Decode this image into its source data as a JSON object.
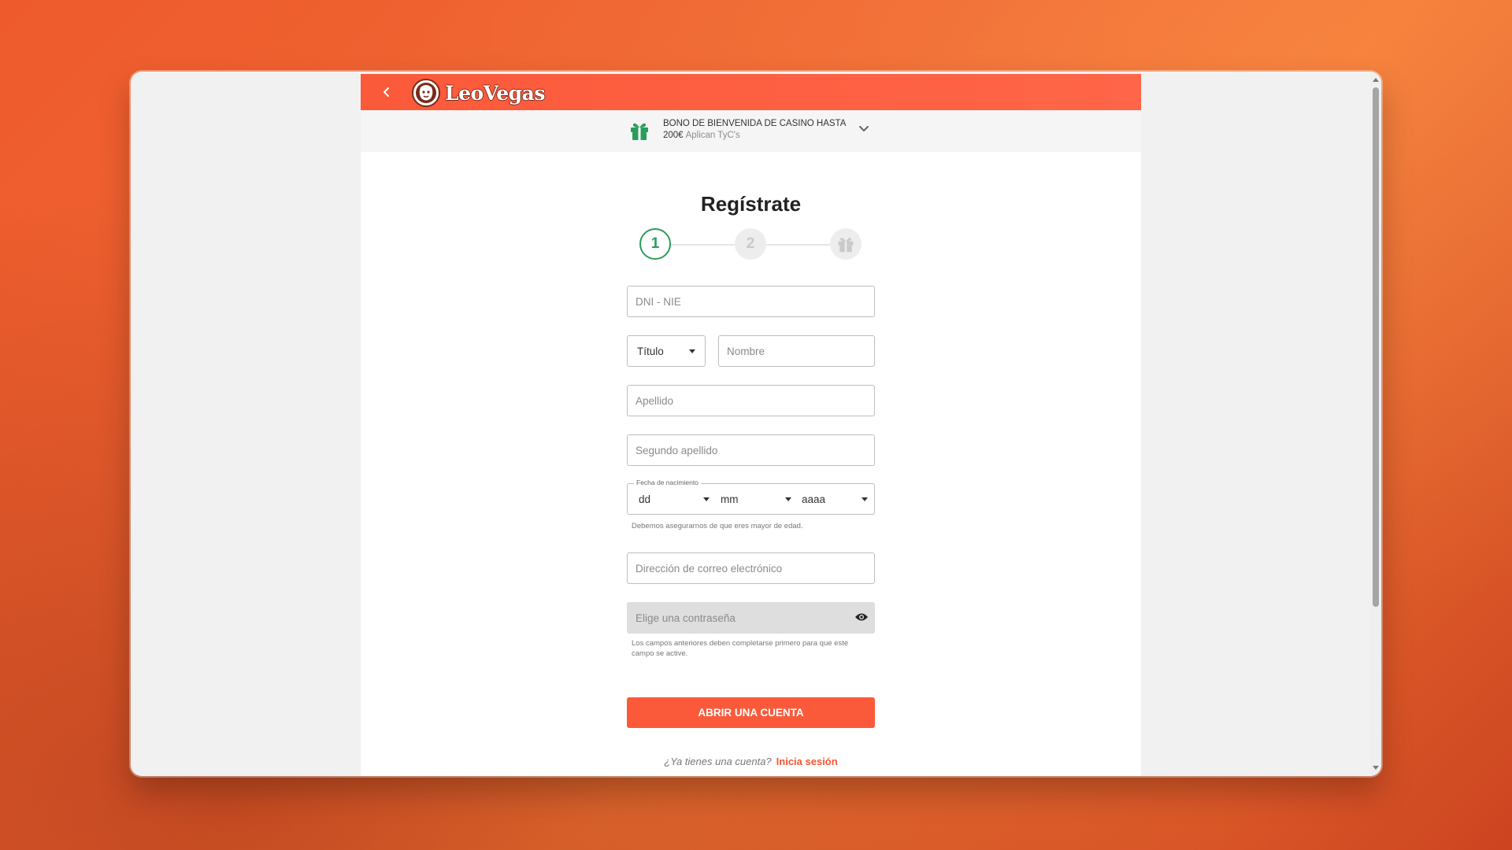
{
  "brand": {
    "name": "LeoVegas",
    "accent": "#fb5a3a",
    "success": "#2a9d5c"
  },
  "promo": {
    "title": "BONO DE BIENVENIDA DE CASINO HASTA",
    "amount": "200€",
    "terms": "Aplican TyC's",
    "icon": "gift-icon"
  },
  "form": {
    "title": "Regístrate",
    "steps": [
      {
        "label": "1",
        "state": "active"
      },
      {
        "label": "2",
        "state": "inactive"
      },
      {
        "label": "",
        "icon": "gift-icon",
        "state": "inactive"
      }
    ],
    "dni_placeholder": "DNI - NIE",
    "title_select": "Título",
    "nombre_placeholder": "Nombre",
    "apellido_placeholder": "Apellido",
    "segundo_apellido_placeholder": "Segundo apellido",
    "dob": {
      "legend": "Fecha de nacimiento",
      "day": "dd",
      "month": "mm",
      "year": "aaaa",
      "hint": "Debemos asegurarnos de que eres mayor de edad."
    },
    "email_placeholder": "Dirección de correo electrónico",
    "password_placeholder": "Elige una contraseña",
    "password_hint": "Los campos anteriores deben completarse primero para que este campo se active.",
    "submit_label": "ABRIR UNA CUENTA",
    "login_question": "¿Ya tienes una cuenta?",
    "login_link": "Inicia sesión"
  }
}
